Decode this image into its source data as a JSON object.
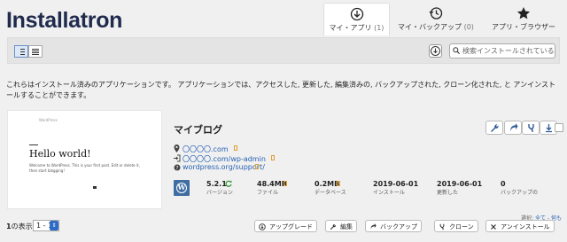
{
  "header": {
    "logo": "Installatron"
  },
  "tabs": [
    {
      "label": "マイ・アプリ",
      "count": "(1)",
      "icon": "download-circle-icon",
      "active": true
    },
    {
      "label": "マイ・バックアップ",
      "count": "(0)",
      "icon": "history-clock-icon",
      "active": false
    },
    {
      "label": "アプリ・ブラウザー",
      "count": "",
      "icon": "star-icon",
      "active": false
    }
  ],
  "toolbar": {
    "search_placeholder": "検索インストールされている"
  },
  "description": "これらはインストール済みのアプリケーションです。 アプリケーションでは、アクセスした, 更新した, 編集済みの, バックアップされた, クローン化された, と アンインストールすることができます。",
  "app": {
    "preview": {
      "site": "WordPress",
      "post_title": "Hello world!",
      "excerpt": "Welcome to WordPress. This is your first post. Edit or delete it, then start blogging!"
    },
    "title": "マイブログ",
    "links": [
      "〇〇〇〇.com",
      "〇〇〇〇.com/wp-admin",
      "wordpress.org/support/"
    ],
    "stats": [
      {
        "value": "5.2.1",
        "label": "バージョン"
      },
      {
        "value": "48.4MB",
        "label": "ファイル"
      },
      {
        "value": "0.2MB",
        "label": "データベース"
      },
      {
        "value": "2019-06-01",
        "label": "インストール"
      },
      {
        "value": "2019-06-01",
        "label": "更新した"
      },
      {
        "value": "0",
        "label": "バックアップの"
      }
    ]
  },
  "selection": {
    "label": "選択:",
    "all": "全て",
    "sep": " - ",
    "none": "何も"
  },
  "pager": {
    "shown": "1",
    "label": "の表示",
    "range": "1 - 1"
  },
  "bottom_buttons": [
    "アップグレード",
    "編集",
    "バックアップ",
    "クローン",
    "アンインストール"
  ],
  "colors": {
    "accent": "#2561b4",
    "brand": "#1f2a4d"
  }
}
